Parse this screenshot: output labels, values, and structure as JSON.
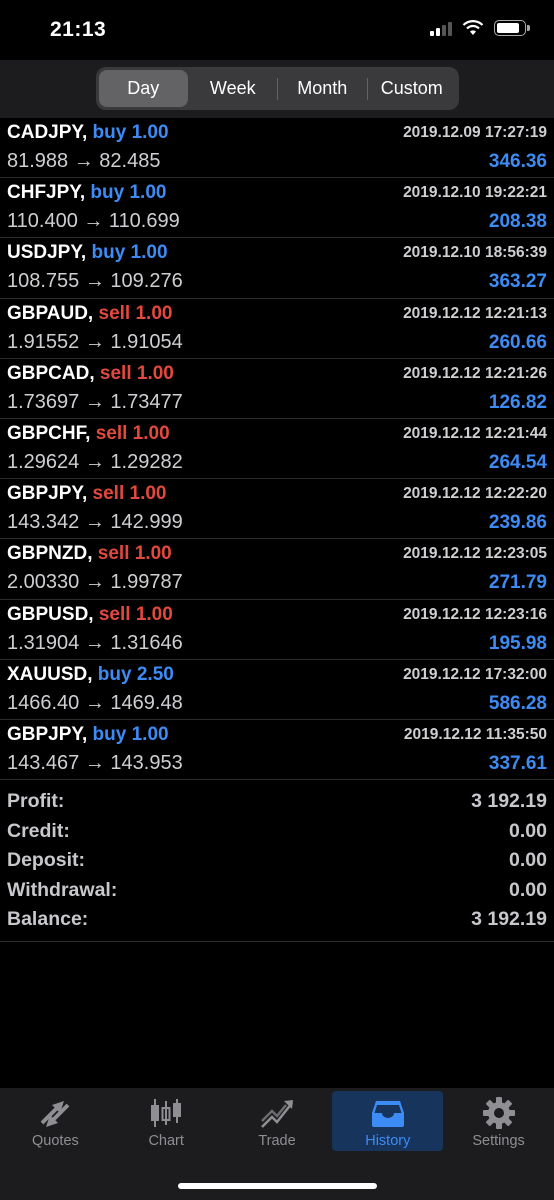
{
  "status": {
    "time": "21:13"
  },
  "segments": {
    "items": [
      "Day",
      "Week",
      "Month",
      "Custom"
    ],
    "active": "Day"
  },
  "deals": [
    {
      "symbol": "CADJPY,",
      "type": "buy",
      "volume_text": "buy 1.00",
      "time": "2019.12.09 17:27:19",
      "prices": "81.988 → 82.485",
      "profit": "346.36"
    },
    {
      "symbol": "CHFJPY,",
      "type": "buy",
      "volume_text": "buy 1.00",
      "time": "2019.12.10 19:22:21",
      "prices": "110.400 → 110.699",
      "profit": "208.38"
    },
    {
      "symbol": "USDJPY,",
      "type": "buy",
      "volume_text": "buy 1.00",
      "time": "2019.12.10 18:56:39",
      "prices": "108.755 → 109.276",
      "profit": "363.27"
    },
    {
      "symbol": "GBPAUD,",
      "type": "sell",
      "volume_text": "sell 1.00",
      "time": "2019.12.12 12:21:13",
      "prices": "1.91552 → 1.91054",
      "profit": "260.66"
    },
    {
      "symbol": "GBPCAD,",
      "type": "sell",
      "volume_text": "sell 1.00",
      "time": "2019.12.12 12:21:26",
      "prices": "1.73697 → 1.73477",
      "profit": "126.82"
    },
    {
      "symbol": "GBPCHF,",
      "type": "sell",
      "volume_text": "sell 1.00",
      "time": "2019.12.12 12:21:44",
      "prices": "1.29624 → 1.29282",
      "profit": "264.54"
    },
    {
      "symbol": "GBPJPY,",
      "type": "sell",
      "volume_text": "sell 1.00",
      "time": "2019.12.12 12:22:20",
      "prices": "143.342 → 142.999",
      "profit": "239.86"
    },
    {
      "symbol": "GBPNZD,",
      "type": "sell",
      "volume_text": "sell 1.00",
      "time": "2019.12.12 12:23:05",
      "prices": "2.00330 → 1.99787",
      "profit": "271.79"
    },
    {
      "symbol": "GBPUSD,",
      "type": "sell",
      "volume_text": "sell 1.00",
      "time": "2019.12.12 12:23:16",
      "prices": "1.31904 → 1.31646",
      "profit": "195.98"
    },
    {
      "symbol": "XAUUSD,",
      "type": "buy",
      "volume_text": "buy 2.50",
      "time": "2019.12.12 17:32:00",
      "prices": "1466.40 → 1469.48",
      "profit": "586.28"
    },
    {
      "symbol": "GBPJPY,",
      "type": "buy",
      "volume_text": "buy 1.00",
      "time": "2019.12.12 11:35:50",
      "prices": "143.467 → 143.953",
      "profit": "337.61"
    }
  ],
  "summary": [
    {
      "label": "Profit:",
      "value": "3 192.19"
    },
    {
      "label": "Credit:",
      "value": "0.00"
    },
    {
      "label": "Deposit:",
      "value": "0.00"
    },
    {
      "label": "Withdrawal:",
      "value": "0.00"
    },
    {
      "label": "Balance:",
      "value": "3 192.19"
    }
  ],
  "tabs": [
    {
      "label": "Quotes",
      "icon": "quotes-icon"
    },
    {
      "label": "Chart",
      "icon": "chart-icon"
    },
    {
      "label": "Trade",
      "icon": "trade-icon"
    },
    {
      "label": "History",
      "icon": "history-icon",
      "active": true
    },
    {
      "label": "Settings",
      "icon": "settings-icon"
    }
  ],
  "colors": {
    "buy": "#3d8bf5",
    "sell": "#e2483d",
    "accent": "#3d8bf5"
  }
}
